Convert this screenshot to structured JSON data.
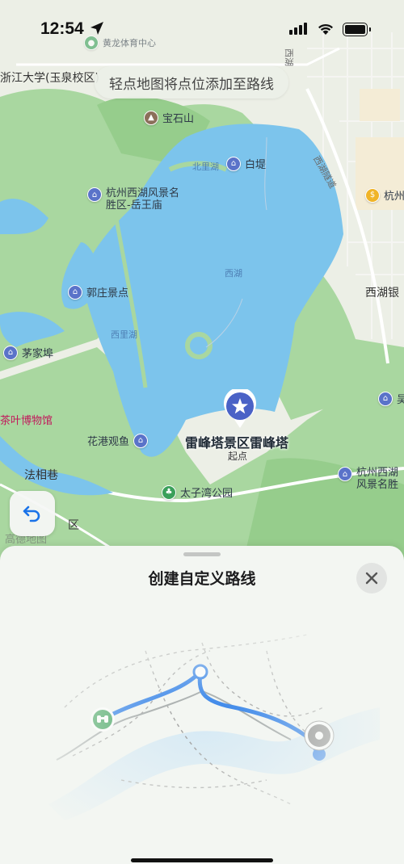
{
  "status": {
    "time": "12:54"
  },
  "hint": "轻点地图将点位添加至路线",
  "map": {
    "pois": {
      "zju": "浙江大学(玉泉校区)",
      "sports": "黄龙体育中心",
      "baoshishan": "宝石山",
      "baidi": "白堤",
      "yuewangmiao": "杭州西湖风景名胜区-岳王庙",
      "guozhuang": "郭庄景点",
      "maojiabu": "茅家埠",
      "huagang": "花港观鱼",
      "taiziwan": "太子湾公园",
      "wansong": "杭州西湖风景名胜区-万松书院",
      "faxiang": "法相巷",
      "xihuyin": "西湖银",
      "hangzhou": "杭州",
      "tea": "茶叶博物馆",
      "wu": "吴"
    },
    "labels": {
      "beilihu": "北里湖",
      "xihu": "西湖",
      "xilihu": "西里湖",
      "tunnel": "西湖隧道",
      "east_road": "西湖",
      "left_edge": "区",
      "left_bottom": "高德地图"
    },
    "start_point": {
      "title": "雷峰塔景区雷峰塔",
      "subtitle": "起点"
    }
  },
  "sheet": {
    "title": "创建自定义路线"
  },
  "colors": {
    "water": "#7cc4ec",
    "park": "#a9d7a0",
    "route": "#1a73e8",
    "accent": "#4a62c6"
  },
  "icons": [
    "location-arrow-icon",
    "signal-icon",
    "wifi-icon",
    "battery-icon",
    "undo-icon",
    "close-icon",
    "star-icon",
    "binoculars-icon"
  ]
}
